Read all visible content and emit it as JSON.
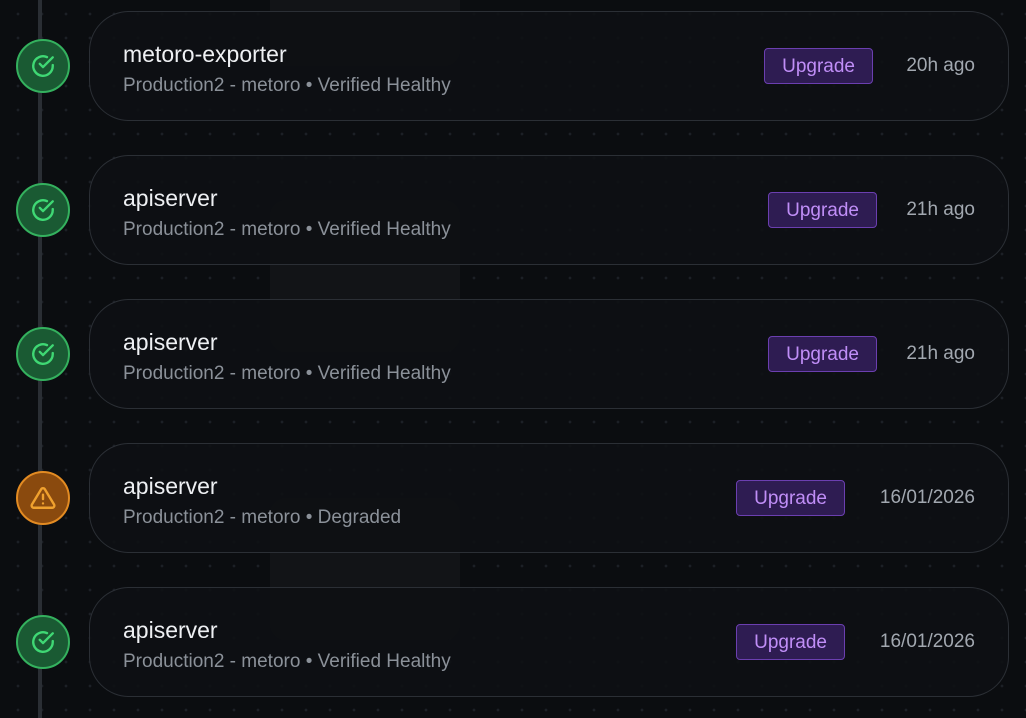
{
  "events": [
    {
      "status": "healthy",
      "status_icon": "check-circle-icon",
      "name": "metoro-exporter",
      "cluster": "Production2 - metoro",
      "separator": "•",
      "health": "Verified Healthy",
      "action_label": "Upgrade",
      "time": "20h ago"
    },
    {
      "status": "healthy",
      "status_icon": "check-circle-icon",
      "name": "apiserver",
      "cluster": "Production2 - metoro",
      "separator": "•",
      "health": "Verified Healthy",
      "action_label": "Upgrade",
      "time": "21h ago"
    },
    {
      "status": "healthy",
      "status_icon": "check-circle-icon",
      "name": "apiserver",
      "cluster": "Production2 - metoro",
      "separator": "•",
      "health": "Verified Healthy",
      "action_label": "Upgrade",
      "time": "21h ago"
    },
    {
      "status": "degraded",
      "status_icon": "warning-triangle-icon",
      "name": "apiserver",
      "cluster": "Production2 - metoro",
      "separator": "•",
      "health": "Degraded",
      "action_label": "Upgrade",
      "time": "16/01/2026"
    },
    {
      "status": "healthy",
      "status_icon": "check-circle-icon",
      "name": "apiserver",
      "cluster": "Production2 - metoro",
      "separator": "•",
      "health": "Verified Healthy",
      "action_label": "Upgrade",
      "time": "16/01/2026"
    }
  ],
  "colors": {
    "background": "#0b0d10",
    "healthy_fill": "#1a5a33",
    "healthy_accent": "#34b15e",
    "degraded_fill": "#8a4a0e",
    "degraded_accent": "#e38b22",
    "upgrade_accent": "#c08ef7"
  }
}
